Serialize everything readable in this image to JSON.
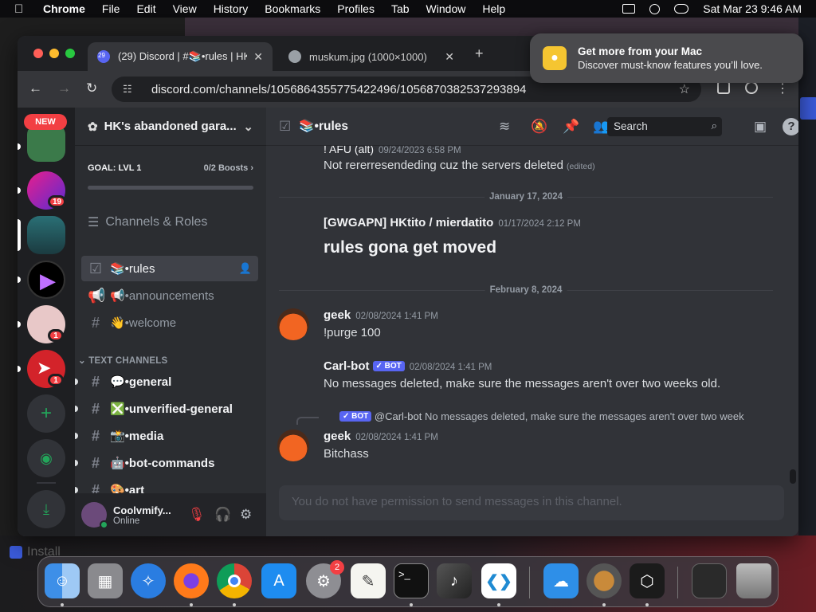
{
  "menubar": {
    "app": "Chrome",
    "items": [
      "File",
      "Edit",
      "View",
      "History",
      "Bookmarks",
      "Profiles",
      "Tab",
      "Window",
      "Help"
    ],
    "datetime": "Sat Mar 23  9:46 AM"
  },
  "notification": {
    "title": "Get more from your Mac",
    "subtitle": "Discover must-know features you’ll love."
  },
  "browser": {
    "tabs": [
      {
        "title": "(29) Discord | #📚•rules | HK'"
      },
      {
        "title": "muskum.jpg (1000×1000)"
      }
    ],
    "tab_badge": "29",
    "url": "discord.com/channels/1056864355775422496/1056870382537293894"
  },
  "guilds": {
    "new_label": "NEW",
    "badges": [
      "19",
      "1",
      "1"
    ]
  },
  "server": {
    "name": "HK's abandoned gara...",
    "goal_label": "GOAL: LVL 1",
    "boosts": "0/2 Boosts",
    "channels_roles": "Channels & Roles",
    "channels_top": [
      {
        "name": "📚•rules"
      },
      {
        "name": "📢•announcements"
      },
      {
        "name": "👋•welcome"
      }
    ],
    "category": "TEXT CHANNELS",
    "channels_text": [
      {
        "name": "💬•general"
      },
      {
        "name": "❎•unverified-general"
      },
      {
        "name": "📸•media"
      },
      {
        "name": "🤖•bot-commands"
      },
      {
        "name": "🎨•art"
      }
    ]
  },
  "user": {
    "name": "Coolvmify...",
    "status": "Online"
  },
  "channel": {
    "name": "📚•rules",
    "search_placeholder": "Search"
  },
  "messages": {
    "m1": {
      "author": "! AFU (alt)",
      "time": "09/24/2023 6:58 PM",
      "text": "Not rererresendeding cuz the servers deleted",
      "edited": "(edited)"
    },
    "d1": "January 17, 2024",
    "m2": {
      "author": "[GWGAPN] HKtito / mierdatito",
      "time": "01/17/2024 2:12 PM",
      "text": "rules gona get moved"
    },
    "d2": "February 8, 2024",
    "m3": {
      "author": "geek",
      "time": "02/08/2024 1:41 PM",
      "text": "!purge 100"
    },
    "m4": {
      "author": "Carl-bot",
      "bot": "✓ BOT",
      "time": "02/08/2024 1:41 PM",
      "text": "No messages deleted, make sure the messages aren't over two weeks old."
    },
    "m5": {
      "reply_bot": "✓ BOT",
      "reply_author": "@Carl-bot",
      "reply_text": "No messages deleted, make sure the messages aren't over two week",
      "author": "geek",
      "time": "02/08/2024 1:41 PM",
      "text": "Bitchass"
    },
    "input_placeholder": "You do not have permission to send messages in this channel."
  },
  "desktop": {
    "ghost_install": "Install",
    "settings_badge": "2"
  },
  "colors": {
    "discord_bg": "#313338",
    "sidebar": "#2b2d31",
    "guild_rail": "#1e1f22",
    "danger": "#f23f43",
    "blurple": "#5865f2",
    "online": "#23a55a"
  }
}
